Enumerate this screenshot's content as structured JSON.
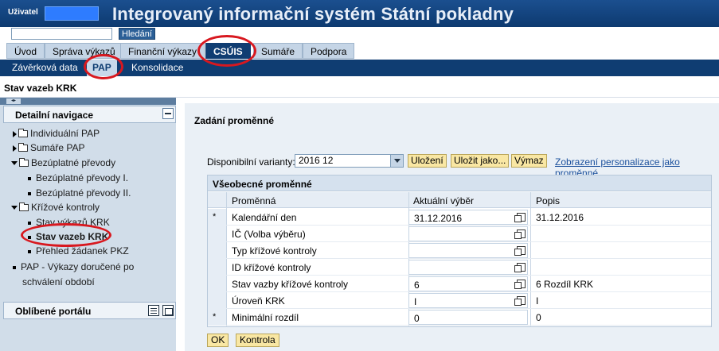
{
  "header": {
    "user_label": "Uživatel",
    "title": "Integrovaný informační systém Státní pokladny"
  },
  "search": {
    "value": "",
    "button_label": "Hledání"
  },
  "tabs_level1": [
    "Úvod",
    "Správa výkazů",
    "Finanční výkazy",
    "CSÚIS",
    "Sumáře",
    "Podpora"
  ],
  "tabs_level2": [
    "Závěrková data",
    "PAP",
    "Konsolidace"
  ],
  "page_title": "Stav vazeb KRK",
  "left_nav": {
    "panel_title": "Detailní navigace",
    "items": [
      "Individuální PAP",
      "Sumáře PAP",
      "Bezúplatné převody",
      "Bezúplatné převody I.",
      "Bezúplatné převody II.",
      "Křížové kontroly",
      "Stav výkazů KRK",
      "Stav vazeb KRK",
      "Přehled žádanek PKZ",
      "PAP - Výkazy doručené po",
      "schválení období"
    ],
    "favorites_title": "Oblíbené portálu"
  },
  "main": {
    "section_title": "Zadání proměnné",
    "variants_label": "Disponibilní varianty:",
    "variant_value": "2016 12",
    "buttons": {
      "save": "Uložení",
      "save_as": "Uložit jako...",
      "delete": "Výmaz"
    },
    "link": "Zobrazení personalizace jako proměnné",
    "grid": {
      "title": "Všeobecné proměnné",
      "columns": [
        "Proměnná",
        "Aktuální výběr",
        "Popis"
      ],
      "rows": [
        {
          "star": "*",
          "name": "Kalendářní den",
          "value": "31.12.2016",
          "desc": "31.12.2016"
        },
        {
          "star": "",
          "name": "IČ (Volba výběru)",
          "value": "",
          "desc": ""
        },
        {
          "star": "",
          "name": "Typ křížové kontroly",
          "value": "",
          "desc": ""
        },
        {
          "star": "",
          "name": "ID křížové kontroly",
          "value": "",
          "desc": ""
        },
        {
          "star": "",
          "name": "Stav vazby křížové kontroly",
          "value": "6",
          "desc": "6 Rozdíl KRK"
        },
        {
          "star": "",
          "name": "Úroveň KRK",
          "value": "I",
          "desc": "I"
        },
        {
          "star": "*",
          "name": "Minimální rozdíl",
          "value": "0",
          "desc": "0"
        }
      ]
    },
    "ok_label": "OK",
    "check_label": "Kontrola"
  }
}
